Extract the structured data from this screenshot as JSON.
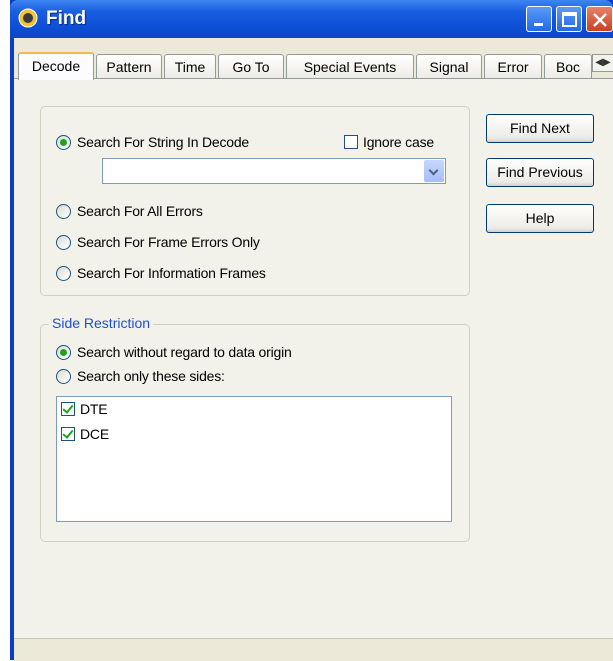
{
  "window": {
    "title": "Find"
  },
  "tabs": [
    "Decode",
    "Pattern",
    "Time",
    "Go To",
    "Special Events",
    "Signal",
    "Error",
    "Boc"
  ],
  "search": {
    "string_in_decode": "Search For String In Decode",
    "ignore_case": "Ignore case",
    "combo_value": "",
    "all_errors": "Search For All Errors",
    "frame_errors": "Search For Frame Errors Only",
    "info_frames": "Search For Information Frames"
  },
  "side_restriction": {
    "title": "Side Restriction",
    "without_regard": "Search without regard to data origin",
    "only_these": "Search only these sides:",
    "items": [
      "DTE",
      "DCE"
    ]
  },
  "buttons": {
    "find_next": "Find Next",
    "find_previous": "Find Previous",
    "help": "Help"
  },
  "colors": {
    "accent": "#1f4fd1",
    "radio_dot": "#21a121",
    "title_bar": "#0d4fd6"
  }
}
